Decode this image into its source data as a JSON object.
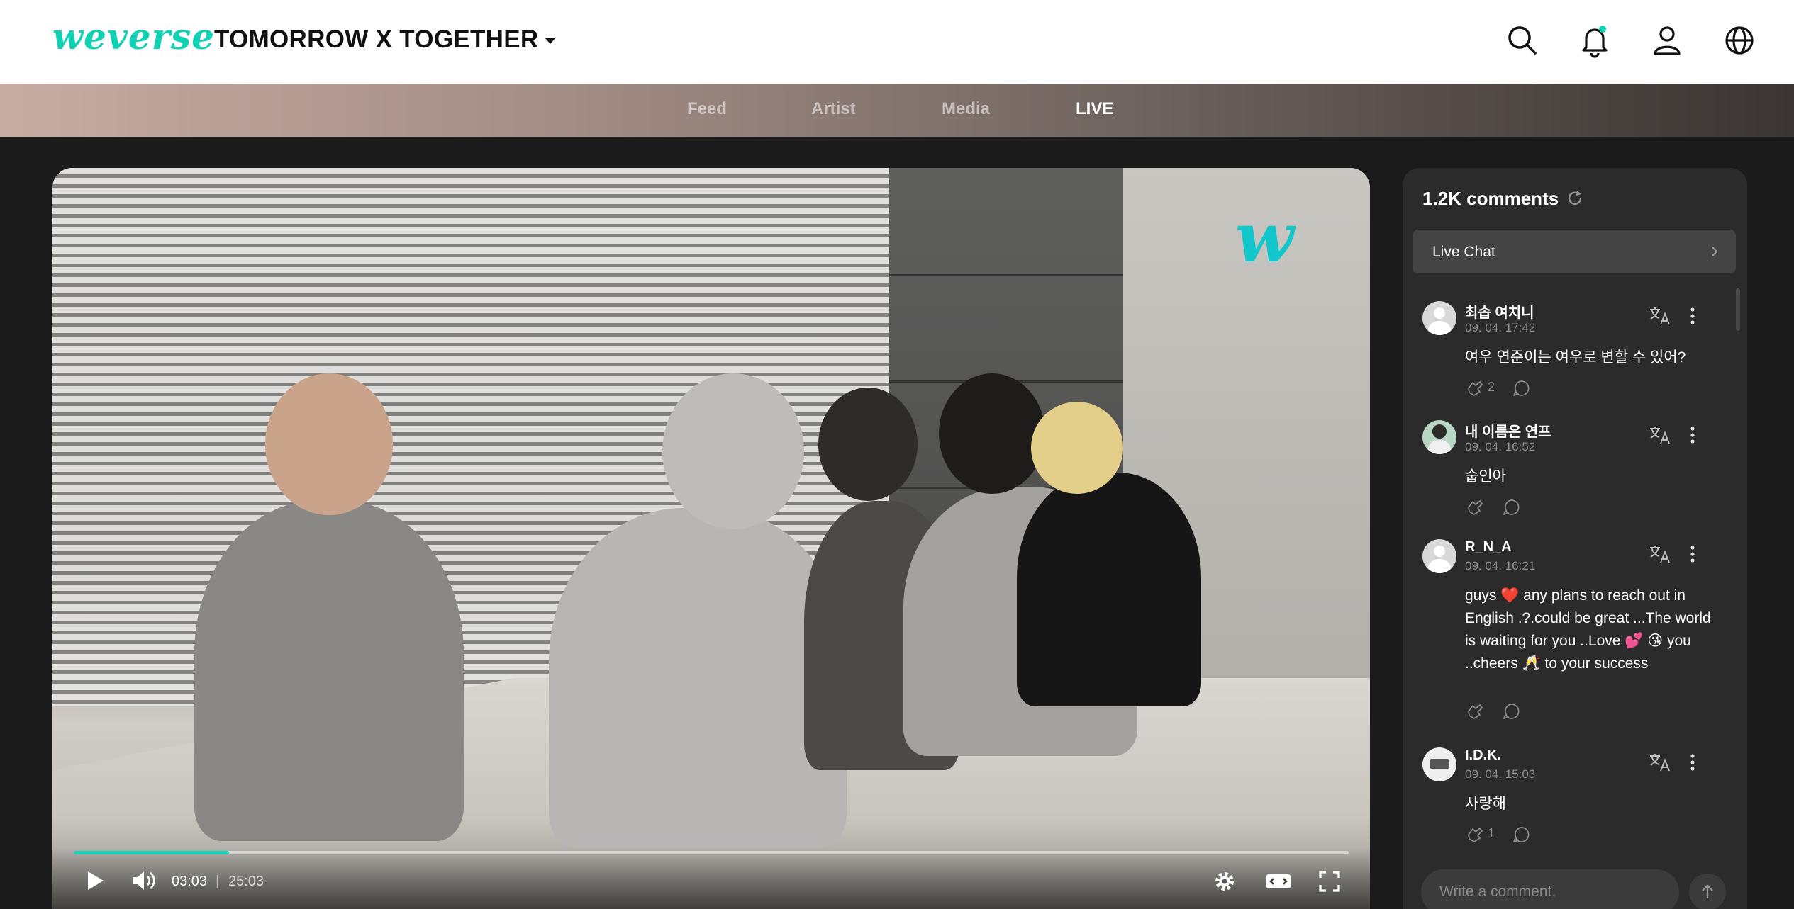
{
  "header": {
    "logo": "weverse",
    "artist": "TOMORROW X TOGETHER",
    "icons": [
      "search-icon",
      "bell-icon",
      "user-icon",
      "globe-icon"
    ],
    "accent": "#0fd2b4"
  },
  "nav": {
    "tabs": [
      {
        "label": "Feed",
        "active": false
      },
      {
        "label": "Artist",
        "active": false
      },
      {
        "label": "Media",
        "active": false
      },
      {
        "label": "LIVE",
        "active": true
      }
    ]
  },
  "player": {
    "current_time": "03:03",
    "total_time": "25:03",
    "progress": 0.122,
    "progress_color": "#1fd0b4",
    "watermark": "w"
  },
  "comments": {
    "count_label": "1.2K comments",
    "live_chat_label": "Live Chat",
    "items": [
      {
        "name": "최솝 여치니",
        "date": "09. 04. 17:42",
        "text": "여우 연준이는 여우로 변할 수 있어?",
        "likes": "2"
      },
      {
        "name": "내 이름은 연프",
        "date": "09. 04. 16:52",
        "text": "숩인아",
        "likes": ""
      },
      {
        "name": "R_N_A",
        "date": "09. 04. 16:21",
        "text": "guys ❤️ any plans to reach out in English .?.could be great ...The world is waiting for you ..Love 💕 😘 you ..cheers 🥂 to your success",
        "likes": ""
      },
      {
        "name": "I.D.K.",
        "date": "09. 04. 15:03",
        "text": "사랑해",
        "likes": "1"
      }
    ],
    "composer_placeholder": "Write a comment."
  }
}
